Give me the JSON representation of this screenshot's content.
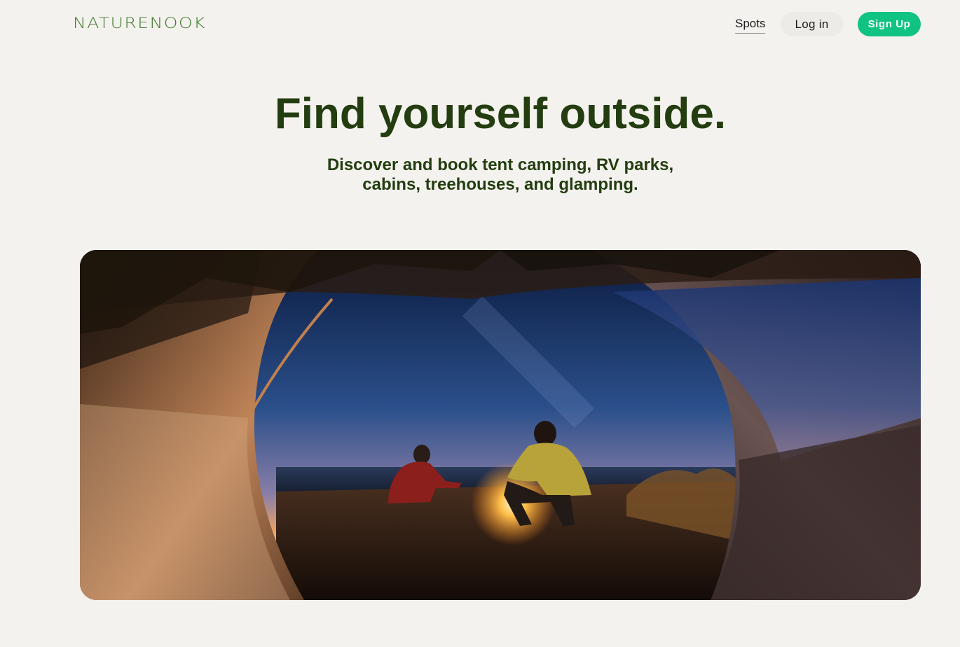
{
  "header": {
    "logo_text": "NATURENOOK",
    "nav": {
      "spots_label": "Spots"
    },
    "login_label": "Log in",
    "signup_label": "Sign Up"
  },
  "hero": {
    "title": "Find yourself outside.",
    "subtitle": "Discover and book tent camping, RV parks, cabins, treehouses, and glamping."
  },
  "colors": {
    "background": "#f4f2ee",
    "brand_green": "#3f7a2c",
    "heading_green": "#233d10",
    "signup_button": "#11c382"
  }
}
